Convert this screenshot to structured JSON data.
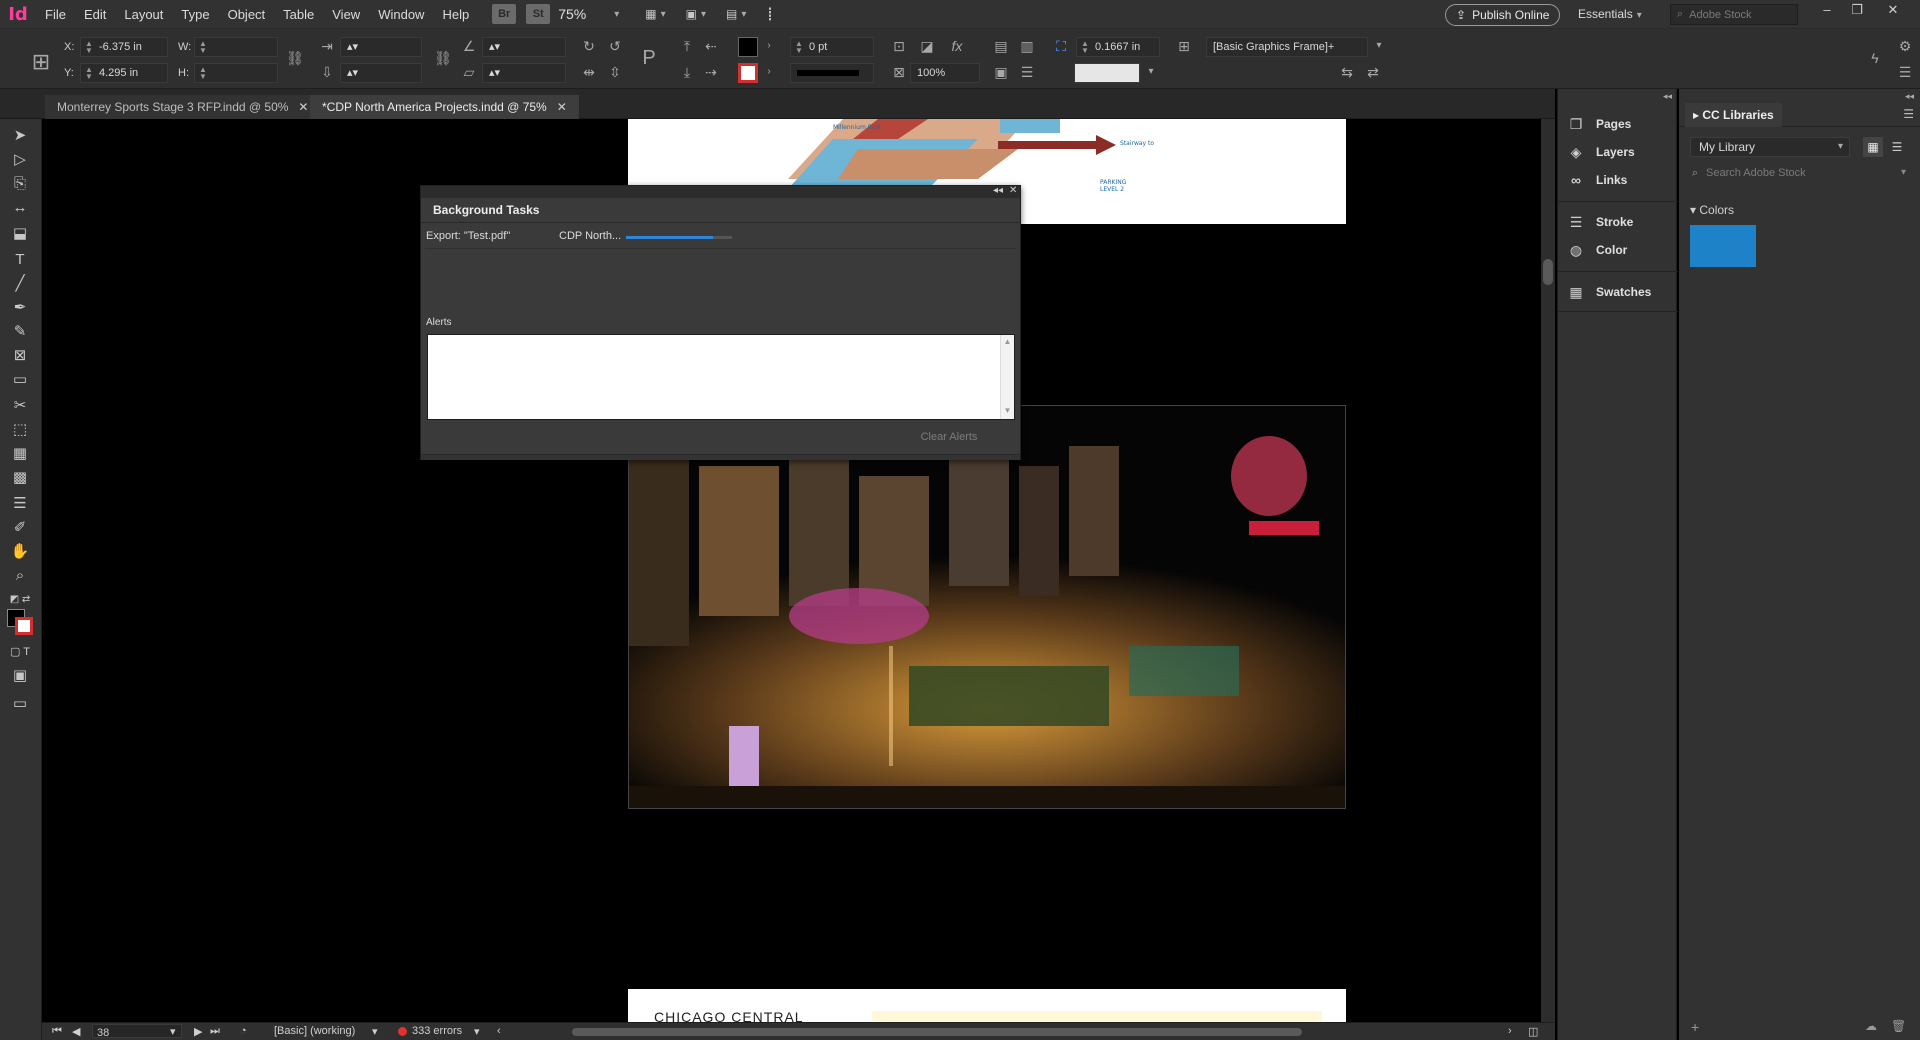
{
  "app": {
    "logo": "Id",
    "menus": [
      "File",
      "Edit",
      "Layout",
      "Type",
      "Object",
      "Table",
      "View",
      "Window",
      "Help"
    ],
    "bridge": "Br",
    "stock": "St",
    "zoom": "75%",
    "publish_label": "Publish Online",
    "workspace": "Essentials",
    "stock_search_placeholder": "Adobe Stock"
  },
  "control": {
    "x_label": "X:",
    "x_value": "-6.375 in",
    "y_label": "Y:",
    "y_value": "4.295 in",
    "w_label": "W:",
    "h_label": "H:",
    "stroke_weight": "0 pt",
    "scale_value": "100%",
    "offset_value": "0.1667 in",
    "object_style": "[Basic Graphics Frame]+"
  },
  "tabs": [
    {
      "label": "Monterrey Sports Stage 3 RFP.indd @ 50%",
      "active": false
    },
    {
      "label": "*CDP North America Projects.indd @ 75%",
      "active": true
    }
  ],
  "status": {
    "page": "38",
    "style": "[Basic] (working)",
    "errors": "333 errors",
    "error_color": "#e0322e"
  },
  "dock": [
    {
      "label": "Pages",
      "icon": "pages-icon"
    },
    {
      "label": "Layers",
      "icon": "layers-icon"
    },
    {
      "label": "Links",
      "icon": "links-icon"
    },
    {
      "label": "Stroke",
      "icon": "stroke-icon"
    },
    {
      "label": "Color",
      "icon": "color-icon"
    },
    {
      "label": "Swatches",
      "icon": "swatches-icon"
    }
  ],
  "cc": {
    "tab": "CC Libraries",
    "library": "My Library",
    "search_placeholder": "Search Adobe Stock",
    "colors_label": "Colors",
    "swatch_color": "#1e82c8"
  },
  "dialog": {
    "title": "Background Tasks",
    "task_name": "Export: \"Test.pdf\"",
    "task_doc": "CDP North...",
    "progress": 0.82,
    "progress_color": "#2f86d6",
    "alerts_label": "Alerts",
    "clear_label": "Clear Alerts"
  },
  "page_text": {
    "bottom_heading": "CHICAGO CENTRAL"
  }
}
